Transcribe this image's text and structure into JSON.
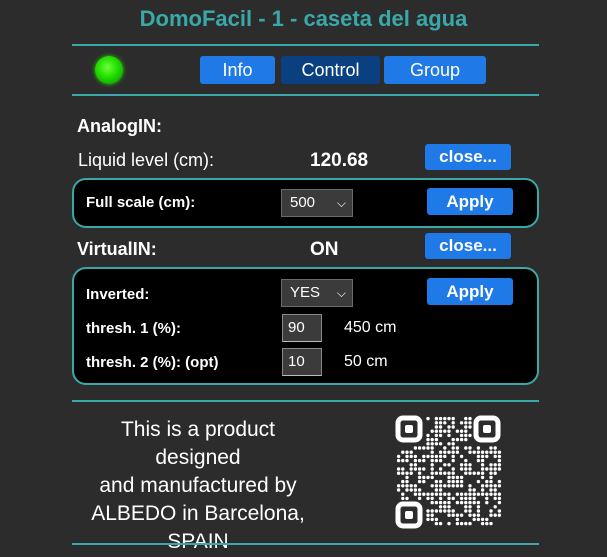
{
  "header": {
    "title": "DomoFacil - 1 - caseta del agua"
  },
  "status": {
    "led_color": "#22dd00"
  },
  "tabs": [
    {
      "label": "Info",
      "active": false
    },
    {
      "label": "Control",
      "active": true
    },
    {
      "label": "Group",
      "active": false
    }
  ],
  "analog": {
    "heading": "AnalogIN:",
    "level_label": "Liquid level (cm):",
    "level_value": "120.68",
    "close_label": "close...",
    "full_scale_label": "Full scale (cm):",
    "full_scale_value": "500",
    "apply_label": "Apply"
  },
  "virtual": {
    "heading": "VirtualIN:",
    "state": "ON",
    "close_label": "close...",
    "inverted_label": "Inverted:",
    "inverted_value": "YES",
    "apply_label": "Apply",
    "thresh1_label": "thresh. 1 (%):",
    "thresh1_value": "90",
    "thresh1_unit": "450 cm",
    "thresh2_label": "thresh. 2 (%): (opt)",
    "thresh2_value": "10",
    "thresh2_unit": "50 cm"
  },
  "footer": {
    "line1": "This is a product designed",
    "line2": "and manufactured by",
    "line3": "ALBEDO in Barcelona,",
    "line4": "SPAIN"
  },
  "colors": {
    "accent": "#3aa8a8",
    "button": "#1f7ae8",
    "tab_active": "#0a3f80",
    "background": "#2c2c2c"
  }
}
